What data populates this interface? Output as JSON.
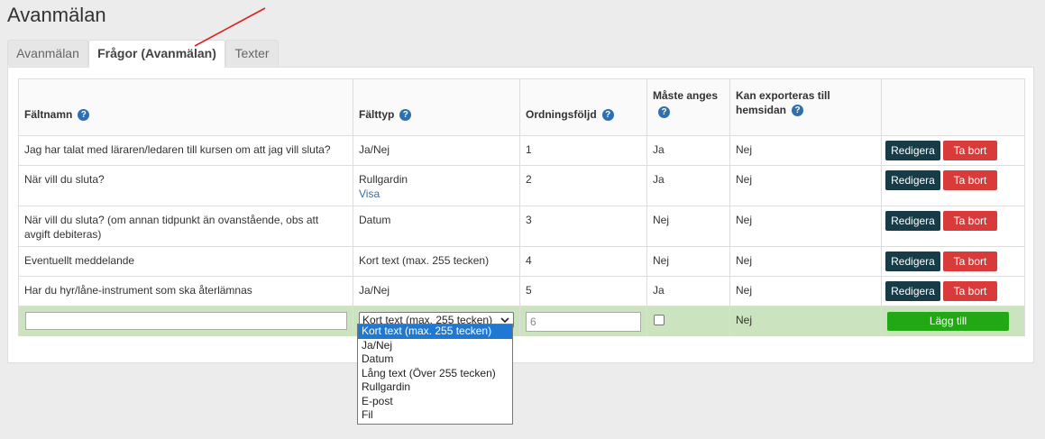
{
  "page": {
    "title": "Avanmälan"
  },
  "tabs": [
    {
      "label": "Avanmälan"
    },
    {
      "label": "Frågor (Avanmälan)"
    },
    {
      "label": "Texter"
    }
  ],
  "table": {
    "headers": {
      "fieldname": "Fältnamn",
      "fieldtype": "Fälttyp",
      "order": "Ordningsföljd",
      "required": "Måste anges",
      "export": "Kan exporteras till hemsidan",
      "help": "?"
    },
    "rows": [
      {
        "name": "Jag har talat med läraren/ledaren till kursen om att jag vill sluta?",
        "type": "Ja/Nej",
        "link": "",
        "order": "1",
        "required": "Ja",
        "export": "Nej"
      },
      {
        "name": "När vill du sluta?",
        "type": "Rullgardin",
        "link": "Visa",
        "order": "2",
        "required": "Ja",
        "export": "Nej"
      },
      {
        "name": "När vill du sluta? (om annan tidpunkt än ovanstående, obs att avgift debiteras)",
        "type": "Datum",
        "link": "",
        "order": "3",
        "required": "Nej",
        "export": "Nej"
      },
      {
        "name": "Eventuellt meddelande",
        "type": "Kort text (max. 255 tecken)",
        "link": "",
        "order": "4",
        "required": "Nej",
        "export": "Nej"
      },
      {
        "name": "Har du hyr/låne-instrument som ska återlämnas",
        "type": "Ja/Nej",
        "link": "",
        "order": "5",
        "required": "Ja",
        "export": "Nej"
      }
    ],
    "edit_label": "Redigera",
    "delete_label": "Ta bort"
  },
  "add_row": {
    "name_value": "",
    "type_selected": "Kort text (max. 255 tecken)",
    "order_placeholder": "6",
    "required_checked": false,
    "export": "Nej",
    "add_label": "Lägg till"
  },
  "dropdown": {
    "options": [
      "Kort text (max. 255 tecken)",
      "Ja/Nej",
      "Datum",
      "Lång text (Över 255 tecken)",
      "Rullgardin",
      "E-post",
      "Fil"
    ]
  },
  "colors": {
    "edit_button": "#173b47",
    "delete_button": "#d93a3a",
    "add_button": "#22a814",
    "add_row_bg": "#cbe3bf",
    "help_icon": "#2d6fb0"
  }
}
